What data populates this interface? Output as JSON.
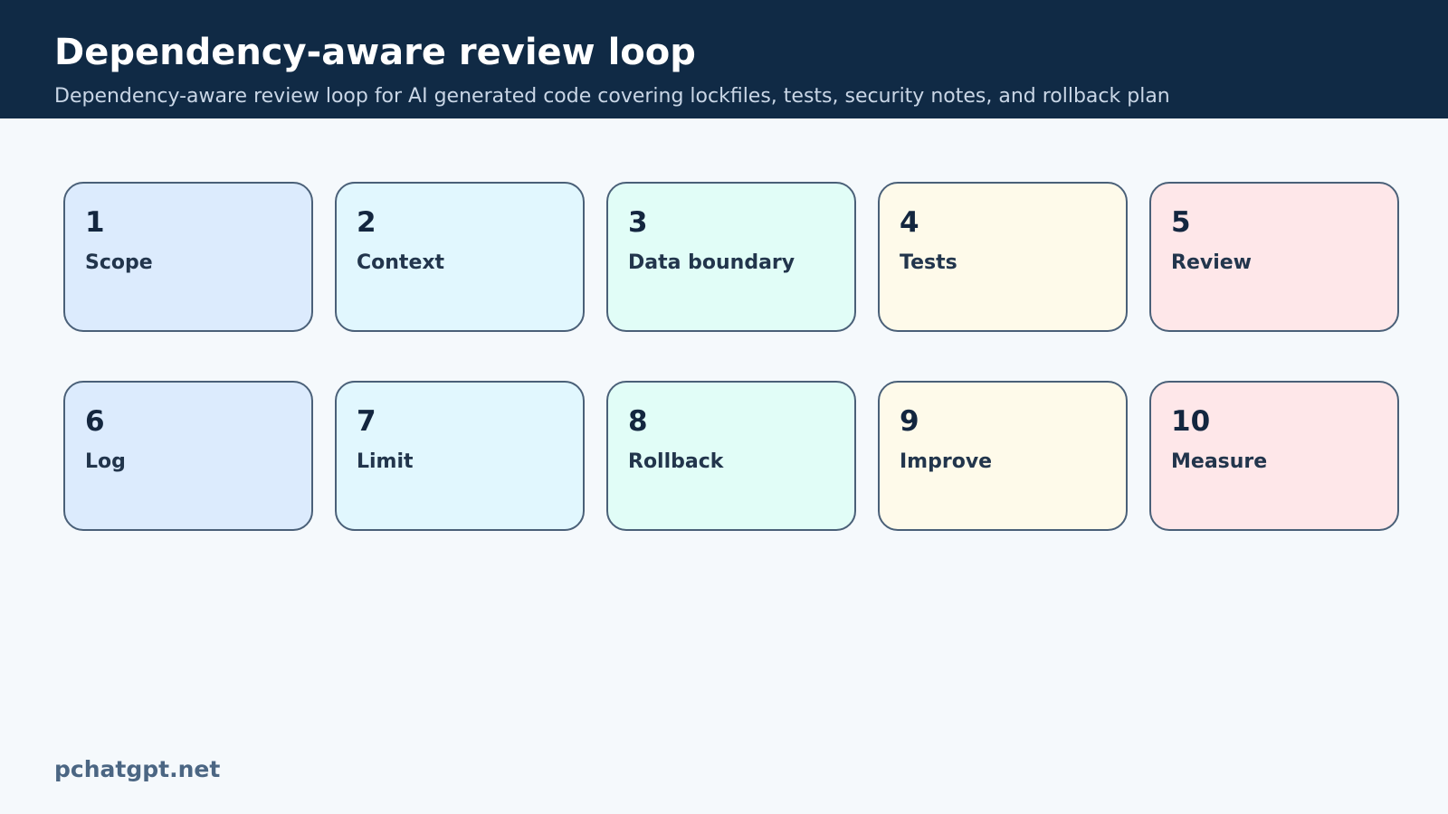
{
  "header": {
    "title": "Dependency-aware review loop",
    "subtitle": "Dependency-aware review loop for AI generated code covering lockfiles, tests, security notes, and rollback plan"
  },
  "steps": [
    {
      "number": "1",
      "label": "Scope",
      "fill": "#dcebfd"
    },
    {
      "number": "2",
      "label": "Context",
      "fill": "#e1f7fe"
    },
    {
      "number": "3",
      "label": "Data boundary",
      "fill": "#e1fdf7"
    },
    {
      "number": "4",
      "label": "Tests",
      "fill": "#fefaea"
    },
    {
      "number": "5",
      "label": "Review",
      "fill": "#fee7e9"
    },
    {
      "number": "6",
      "label": "Log",
      "fill": "#dcebfd"
    },
    {
      "number": "7",
      "label": "Limit",
      "fill": "#e1f7fe"
    },
    {
      "number": "8",
      "label": "Rollback",
      "fill": "#e1fdf7"
    },
    {
      "number": "9",
      "label": "Improve",
      "fill": "#fefaea"
    },
    {
      "number": "10",
      "label": "Measure",
      "fill": "#fee7e9"
    }
  ],
  "colors": {
    "header_background": "#102a45",
    "page_background": "#f5f9fc",
    "card_border": "#4a6078"
  },
  "footer": {
    "brand": "pchatgpt.net"
  }
}
